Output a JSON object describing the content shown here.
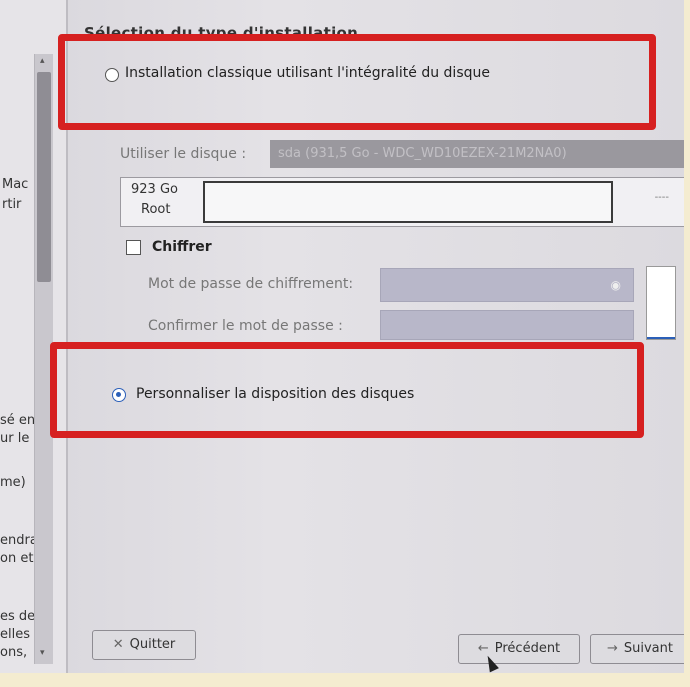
{
  "sidebar": {
    "lines": [
      "Mac",
      "rtir",
      "sé en",
      "ur le",
      "me)",
      "endra",
      "on et",
      "es de",
      "elles",
      "ons,"
    ]
  },
  "main": {
    "section_title": "Sélection du type d'installation",
    "option_classic": {
      "label": "Installation classique utilisant l'intégralité du disque",
      "selected": false
    },
    "disk": {
      "label": "Utiliser le disque :",
      "value": "sda (931,5 Go - WDC_WD10EZEX-21M2NA0)"
    },
    "partition": {
      "size": "923 Go",
      "name": "Root",
      "more": "----"
    },
    "encrypt": {
      "label": "Chiffrer",
      "checked": false,
      "password_label": "Mot de passe de chiffrement:",
      "confirm_label": "Confirmer le mot de passe :"
    },
    "option_custom": {
      "label": "Personnaliser la disposition des disques",
      "selected": true
    }
  },
  "buttons": {
    "quit": "Quitter",
    "previous": "Précédent",
    "next": "Suivant"
  },
  "icons": {
    "quit": "close-icon",
    "previous": "arrow-left-icon",
    "next": "arrow-right-icon",
    "eye": "eye-icon"
  },
  "colors": {
    "highlight": "#d62020",
    "radio_selected": "#2b5fb8"
  }
}
